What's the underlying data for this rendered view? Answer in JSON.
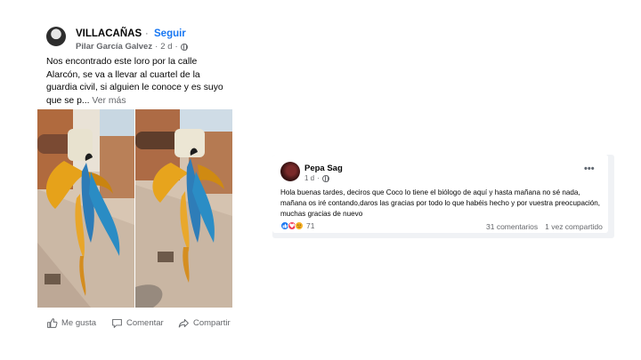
{
  "post1": {
    "group_name": "VILLACAÑAS",
    "separator": "·",
    "follow_label": "Seguir",
    "author": "Pilar García Galvez",
    "time": "2 d",
    "meta_dot": "·",
    "text": "Nos encontrado este loro por la calle Alarcón, se va a llevar al cuartel de la guardia civil, si alguien le conoce y es suyo que se p...",
    "see_more": "Ver más",
    "actions": {
      "like": "Me gusta",
      "comment": "Comentar",
      "share": "Compartir"
    },
    "icons": [
      "globe-icon",
      "thumb-up-icon",
      "comment-icon",
      "share-icon"
    ]
  },
  "post2": {
    "author": "Pepa Sag",
    "time": "1 d",
    "meta_dot": "·",
    "menu": "•••",
    "text": "Hola buenas tardes, deciros que Coco lo tiene el biólogo de aquí y hasta mañana no sé nada, mañana os iré contando,daros las gracias por todo lo que habéis hecho y por vuestra preocupación, muchas gracias de nuevo",
    "reactions_count": "71",
    "comments": "31 comentarios",
    "shares": "1 vez compartido",
    "reaction_colors": {
      "like": "#1877f2",
      "love": "#f33e58",
      "care": "#f7b125"
    }
  },
  "colors": {
    "link_blue": "#1877f2",
    "secondary_text": "#65676b"
  }
}
